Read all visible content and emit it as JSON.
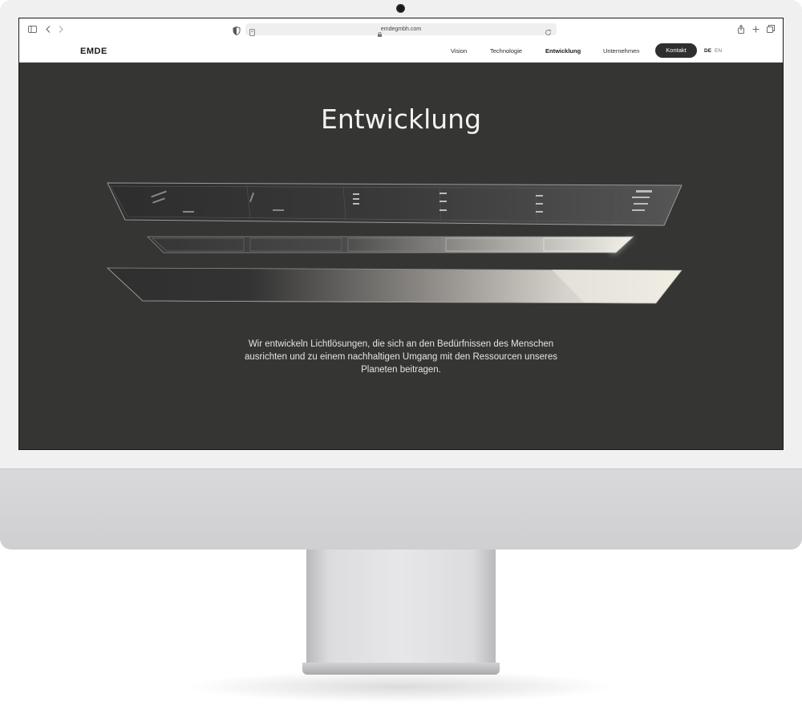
{
  "browser": {
    "url": "emdegmbh.com",
    "icons": {
      "sidebar": "sidebar-icon",
      "back": "chevron-left-icon",
      "forward": "chevron-right-icon",
      "privacy": "shield-icon",
      "reload": "reload-icon",
      "share": "share-icon",
      "new_tab": "plus-icon",
      "tabs": "tabs-overview-icon"
    }
  },
  "site": {
    "logo": "EMDE",
    "nav": [
      {
        "label": "Vision"
      },
      {
        "label": "Technologie"
      },
      {
        "label": "Entwicklung",
        "active": true
      },
      {
        "label": "Unternehmen"
      }
    ],
    "cta": "Kontakt",
    "languages": [
      "DE",
      "EN"
    ],
    "active_language": "DE"
  },
  "hero": {
    "title": "Entwicklung",
    "text": "Wir entwickeln Lichtlösungen, die sich an den Bedürfnissen des Menschen ausrichten und zu einem nachhaltigen Umgang mit den Ressourcen unseres Planeten beitragen."
  },
  "colors": {
    "screen_bg": "#353534",
    "nav_bg": "#ffffff",
    "cta_bg": "#2f2f2f",
    "text_light": "#f2f2f2"
  }
}
